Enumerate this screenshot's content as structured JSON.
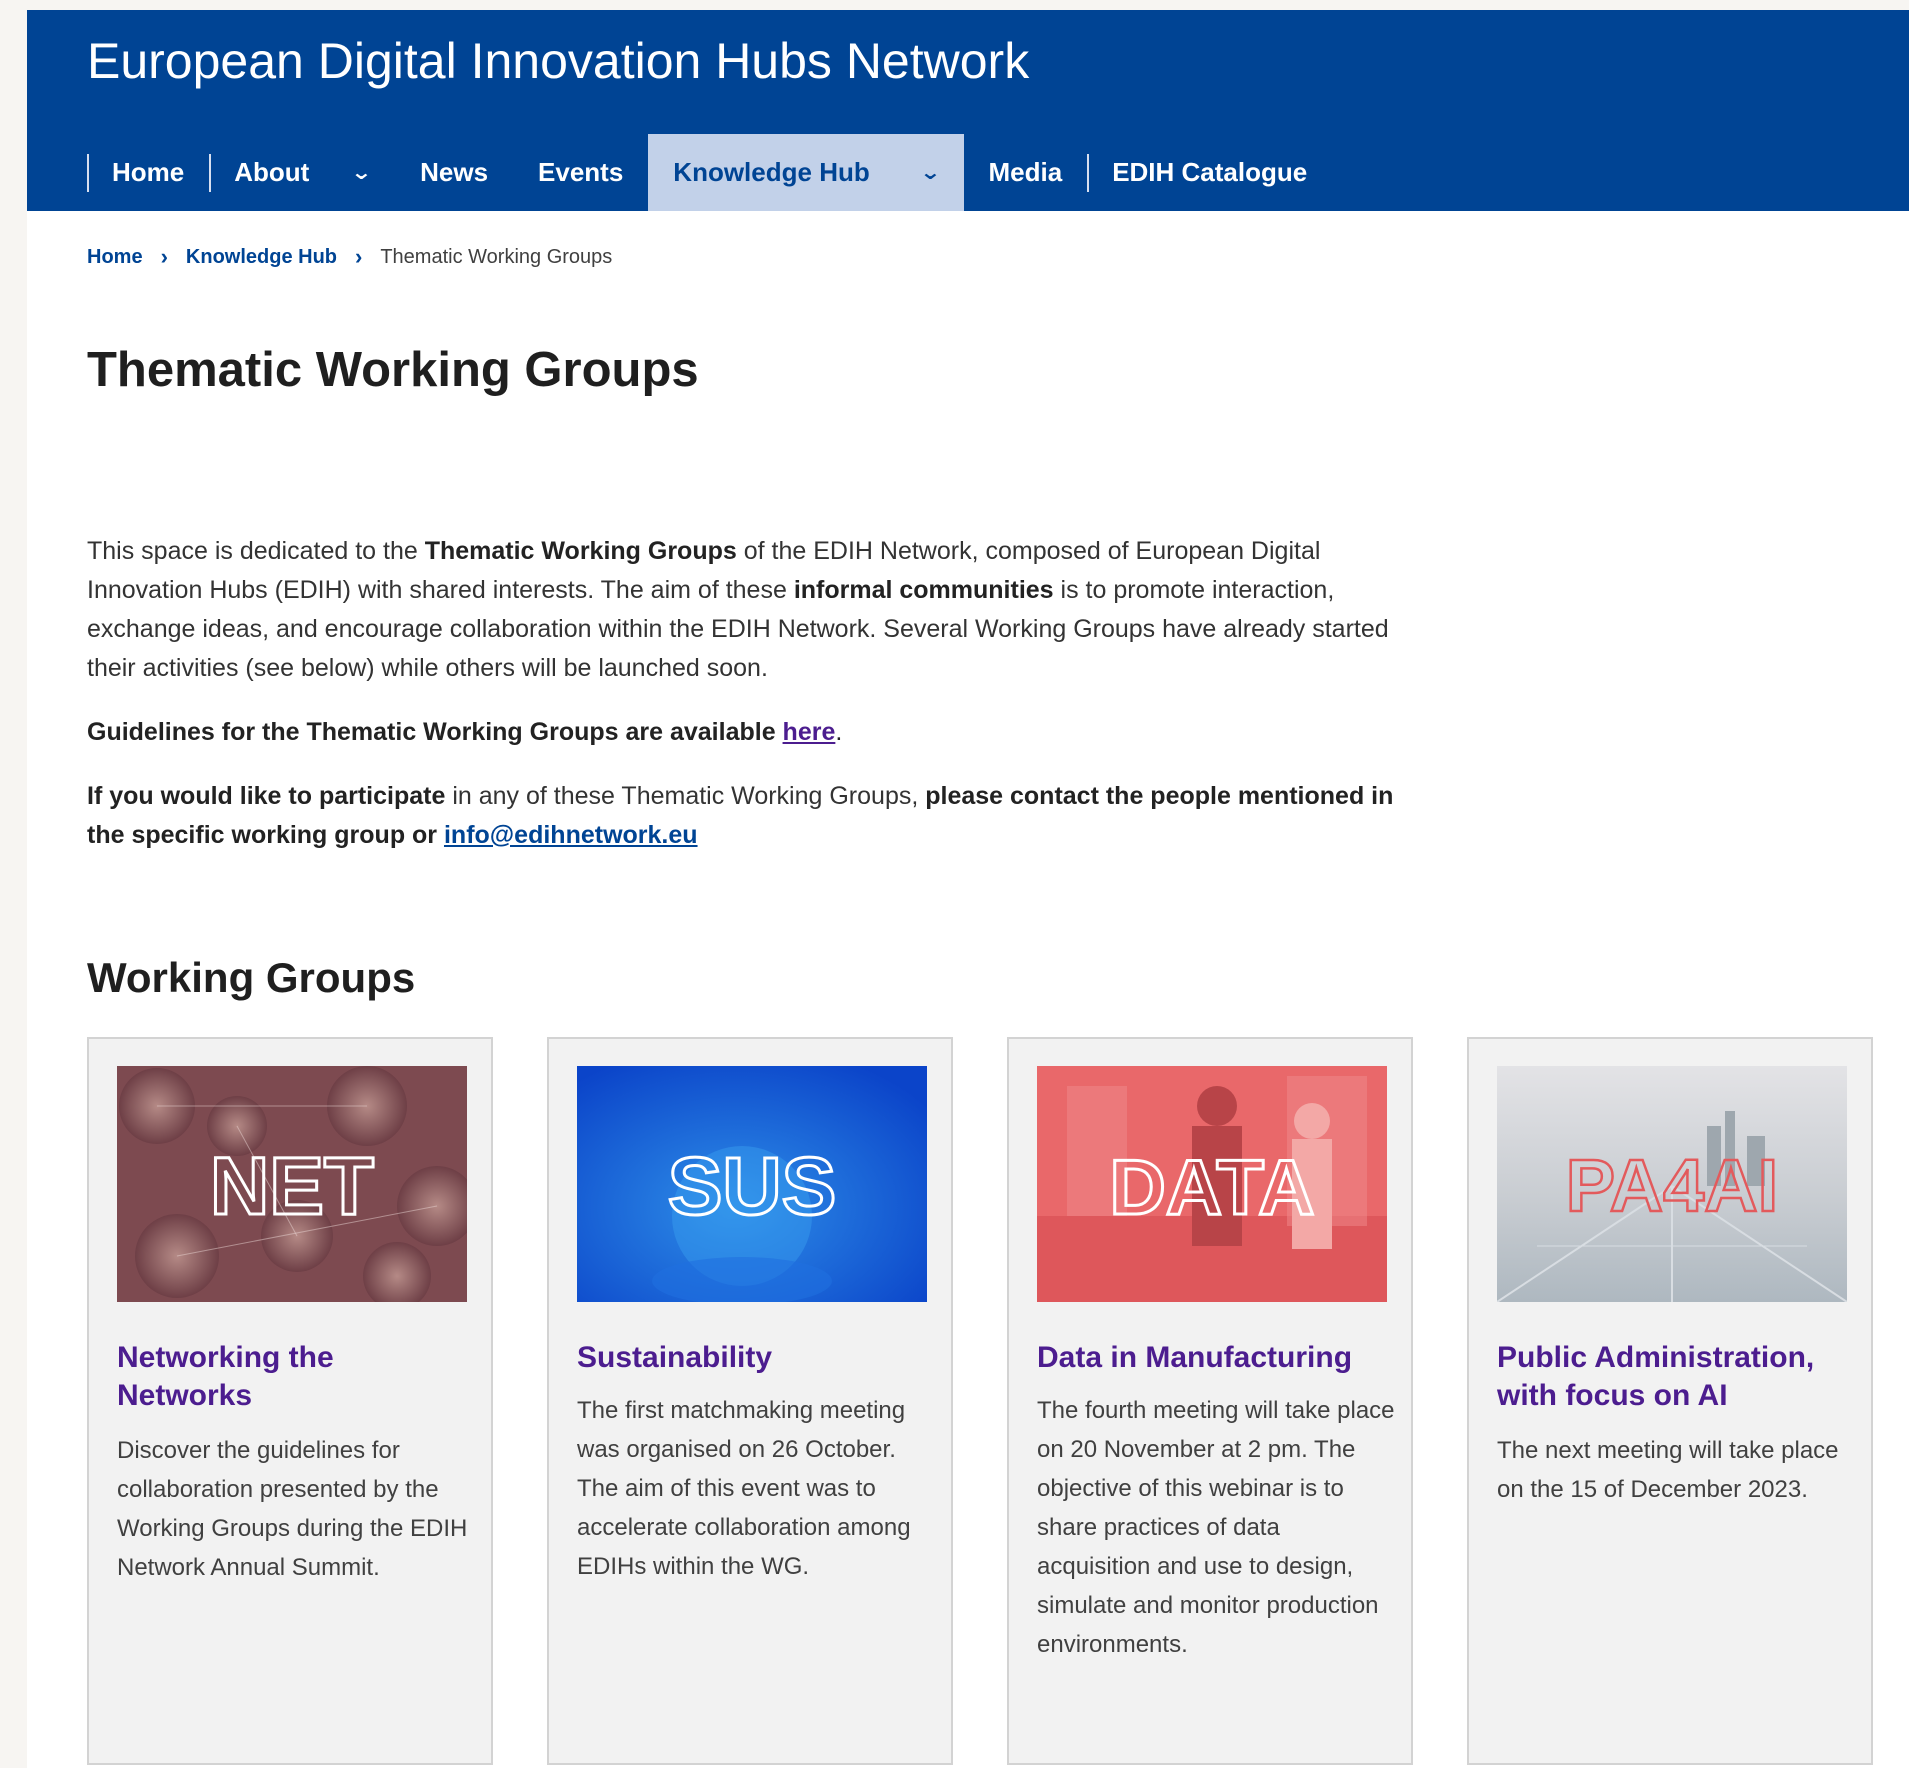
{
  "header": {
    "site_title": "European Digital Innovation Hubs Network",
    "nav": [
      {
        "label": "Home"
      },
      {
        "label": "About"
      },
      {
        "label": "News"
      },
      {
        "label": "Events"
      },
      {
        "label": "Knowledge Hub"
      },
      {
        "label": "Media"
      },
      {
        "label": "EDIH Catalogue"
      }
    ],
    "chevron_glyph": "⌄",
    "active_nav": "Knowledge Hub"
  },
  "breadcrumb": {
    "items": [
      "Home",
      "Knowledge Hub",
      "Thematic Working Groups"
    ],
    "separator": "›"
  },
  "page_title": "Thematic Working Groups",
  "intro": {
    "t1": "This space is dedicated to the ",
    "b1": "Thematic Working Groups",
    "t2": " of the EDIH Network, composed of European Digital Innovation Hubs (EDIH) with shared interests. The aim of these ",
    "b2": "informal communities",
    "t3": " is to promote interaction, exchange ideas, and encourage collaboration within the EDIH Network. Several Working Groups have already started their activities (see below) while others will be launched soon."
  },
  "guidelines": {
    "text": "Guidelines for the Thematic Working Groups are available ",
    "link": "here",
    "end": "."
  },
  "participate": {
    "b1": "If you would like to participate",
    "t1": " in any of these Thematic Working Groups, ",
    "b2": "please contact the people mentioned in the specific working group or ",
    "email": "info@edihnetwork.eu"
  },
  "section_title": "Working Groups",
  "cards": [
    {
      "image_label": "NET",
      "title": "Networking the Networks",
      "text": "Discover the guidelines for collaboration presented by the Working Groups during the EDIH Network Annual Summit."
    },
    {
      "image_label": "SUS",
      "title": "Sustainability",
      "text": "The first matchmaking meeting was organised on 26 October. The aim of this event was to accelerate collaboration among EDIHs within the WG."
    },
    {
      "image_label": "DATA",
      "title": "Data in Manufacturing",
      "text": "The fourth meeting will take place on 20 November at 2 pm. The objective of this webinar is to share practices of data acquisition and use to design, simulate and monitor production environments."
    },
    {
      "image_label": "PA4AI",
      "title": "Public Administration, with focus on AI",
      "text": "The next meeting will take place on the 15 of December 2023."
    }
  ],
  "colors": {
    "header_bg": "#004494",
    "nav_active_bg": "#c2d1e9",
    "card_title": "#4c1d8f",
    "link": "#004494"
  }
}
